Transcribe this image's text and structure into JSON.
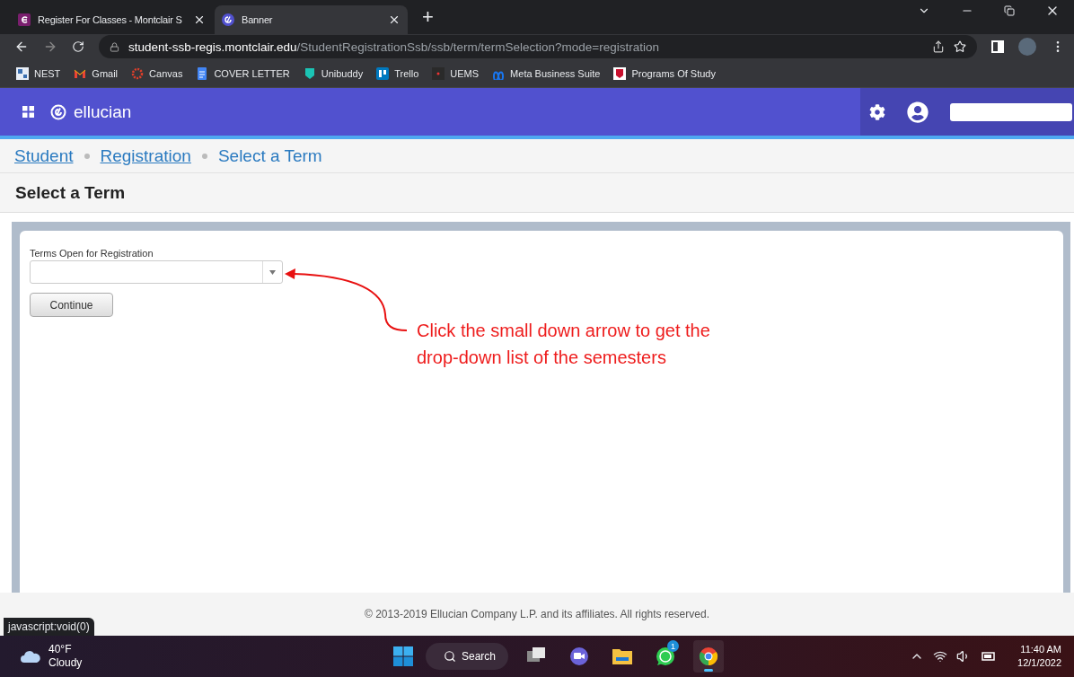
{
  "browser": {
    "tabs": [
      {
        "title": "Register For Classes - Montclair S",
        "kind": "letter-e",
        "selected": false
      },
      {
        "title": "Banner",
        "kind": "ellucian",
        "selected": true
      }
    ],
    "new_tab": "+",
    "address": {
      "host": "student-ssb-regis.montclair.edu",
      "path": "/StudentRegistrationSsb/ssb/term/termSelection?mode=registration"
    },
    "bookmarks": [
      {
        "label": "NEST",
        "kind": "nest"
      },
      {
        "label": "Gmail",
        "kind": "gmail"
      },
      {
        "label": "Canvas",
        "kind": "canvas"
      },
      {
        "label": "COVER LETTER",
        "kind": "docs"
      },
      {
        "label": "Unibuddy",
        "kind": "unibuddy"
      },
      {
        "label": "Trello",
        "kind": "trello"
      },
      {
        "label": "UEMS",
        "kind": "uems"
      },
      {
        "label": "Meta Business Suite",
        "kind": "meta"
      },
      {
        "label": "Programs Of Study",
        "kind": "crest"
      }
    ]
  },
  "app_header": {
    "brand": "ellucian"
  },
  "breadcrumb": [
    {
      "label": "Student",
      "link": true
    },
    {
      "label": "Registration",
      "link": true
    },
    {
      "label": "Select a Term",
      "link": false
    }
  ],
  "page_title": "Select a Term",
  "form": {
    "label": "Terms Open for Registration",
    "button": "Continue"
  },
  "annotation": {
    "lines": [
      "Click the small down arrow to get the",
      "drop-down list of the semesters"
    ]
  },
  "footer": "© 2013-2019 Ellucian Company L.P. and its affiliates. All rights reserved.",
  "status_link": "javascript:void(0)",
  "taskbar": {
    "weather": {
      "temp": "40°F",
      "condition": "Cloudy"
    },
    "search": "Search",
    "apps": [
      {
        "kind": "taskview",
        "selected": false
      },
      {
        "kind": "meet",
        "selected": false
      },
      {
        "kind": "folder",
        "selected": false
      },
      {
        "kind": "whatsapp",
        "selected": false,
        "badge": "1"
      },
      {
        "kind": "chrome",
        "selected": true
      }
    ],
    "time": "11:40 AM",
    "date": "12/1/2022"
  }
}
